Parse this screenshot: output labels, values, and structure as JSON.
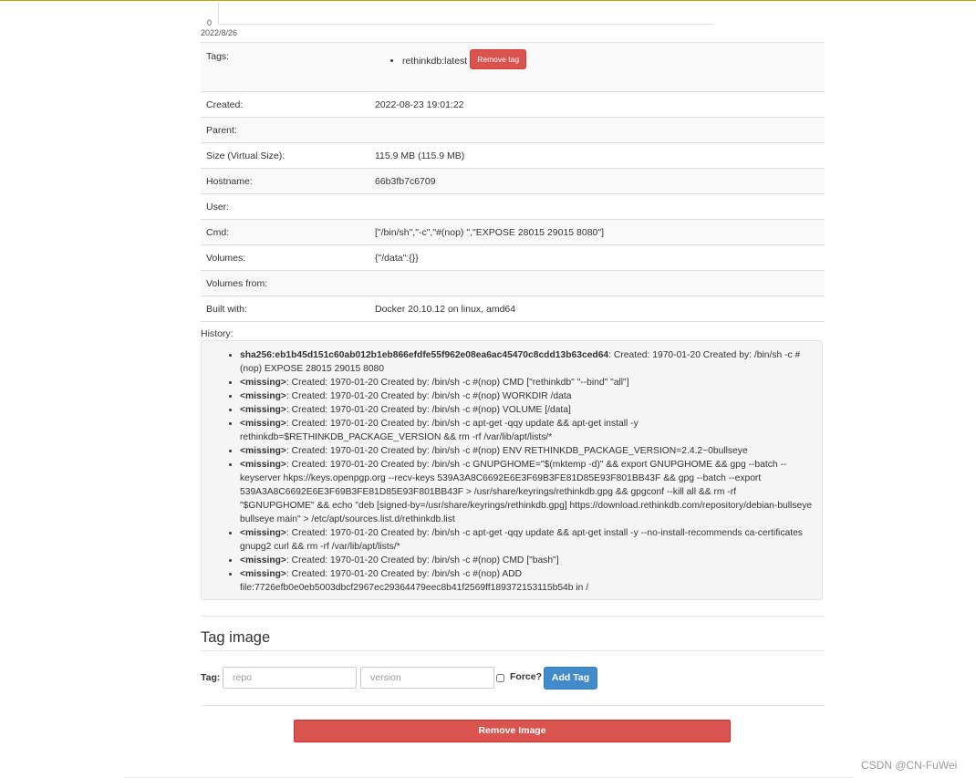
{
  "chart": {
    "y_tick": "0",
    "x_tick": "2022/8/26"
  },
  "info": {
    "tags_label": "Tags:",
    "tags": [
      "rethinkdb:latest"
    ],
    "remove_tag_label": "Remove tag",
    "rows": [
      {
        "key": "Created:",
        "value": "2022-08-23 19:01:22"
      },
      {
        "key": "Parent:",
        "value": ""
      },
      {
        "key": "Size (Virtual Size):",
        "value": "115.9 MB (115.9 MB)"
      },
      {
        "key": "Hostname:",
        "value": "66b3fb7c6709"
      },
      {
        "key": "User:",
        "value": ""
      },
      {
        "key": "Cmd:",
        "value": "[\"/bin/sh\",\"-c\",\"#(nop) \",\"EXPOSE 28015 29015 8080\"]"
      },
      {
        "key": "Volumes:",
        "value": "{\"/data\":{}}"
      },
      {
        "key": "Volumes from:",
        "value": ""
      },
      {
        "key": "Built with:",
        "value": "Docker 20.10.12 on linux, amd64"
      }
    ]
  },
  "history": {
    "label": "History:",
    "items": [
      {
        "id": "sha256:eb1b45d151c60ab012b1eb866efdfe55f962e08ea6ac45470c8cdd13b63ced64",
        "text": ": Created: 1970-01-20 Created by: /bin/sh -c #(nop) EXPOSE 28015 29015 8080"
      },
      {
        "id": "<missing>",
        "text": ": Created: 1970-01-20 Created by: /bin/sh -c #(nop) CMD [\"rethinkdb\" \"--bind\" \"all\"]"
      },
      {
        "id": "<missing>",
        "text": ": Created: 1970-01-20 Created by: /bin/sh -c #(nop) WORKDIR /data"
      },
      {
        "id": "<missing>",
        "text": ": Created: 1970-01-20 Created by: /bin/sh -c #(nop) VOLUME [/data]"
      },
      {
        "id": "<missing>",
        "text": ": Created: 1970-01-20 Created by: /bin/sh -c apt-get -qqy update && apt-get install -y rethinkdb=$RETHINKDB_PACKAGE_VERSION && rm -rf /var/lib/apt/lists/*"
      },
      {
        "id": "<missing>",
        "text": ": Created: 1970-01-20 Created by: /bin/sh -c #(nop) ENV RETHINKDB_PACKAGE_VERSION=2.4.2~0bullseye"
      },
      {
        "id": "<missing>",
        "text": ": Created: 1970-01-20 Created by: /bin/sh -c GNUPGHOME=\"$(mktemp -d)\" && export GNUPGHOME && gpg --batch --keyserver hkps://keys.openpgp.org --recv-keys 539A3A8C6692E6E3F69B3FE81D85E93F801BB43F && gpg --batch --export 539A3A8C6692E6E3F69B3FE81D85E93F801BB43F > /usr/share/keyrings/rethinkdb.gpg && gpgconf --kill all && rm -rf \"$GNUPGHOME\" && echo \"deb [signed-by=/usr/share/keyrings/rethinkdb.gpg] https://download.rethinkdb.com/repository/debian-bullseye bullseye main\" > /etc/apt/sources.list.d/rethinkdb.list"
      },
      {
        "id": "<missing>",
        "text": ": Created: 1970-01-20 Created by: /bin/sh -c apt-get -qqy update && apt-get install -y --no-install-recommends ca-certificates gnupg2 curl && rm -rf /var/lib/apt/lists/*"
      },
      {
        "id": "<missing>",
        "text": ": Created: 1970-01-20 Created by: /bin/sh -c #(nop) CMD [\"bash\"]"
      },
      {
        "id": "<missing>",
        "text": ": Created: 1970-01-20 Created by: /bin/sh -c #(nop) ADD file:7726efb0e0eb5003dbcf2967ec29364479eec8b41f2569ff189372153115b54b in /"
      }
    ]
  },
  "tag_image": {
    "heading": "Tag image",
    "label": "Tag:",
    "repo_placeholder": "repo",
    "version_placeholder": "version",
    "force_label": "Force?",
    "add_label": "Add Tag"
  },
  "remove_image_label": "Remove Image",
  "watermark": "CSDN @CN-FuWei",
  "colors": {
    "danger": "#d9534f",
    "primary": "#428bca"
  }
}
